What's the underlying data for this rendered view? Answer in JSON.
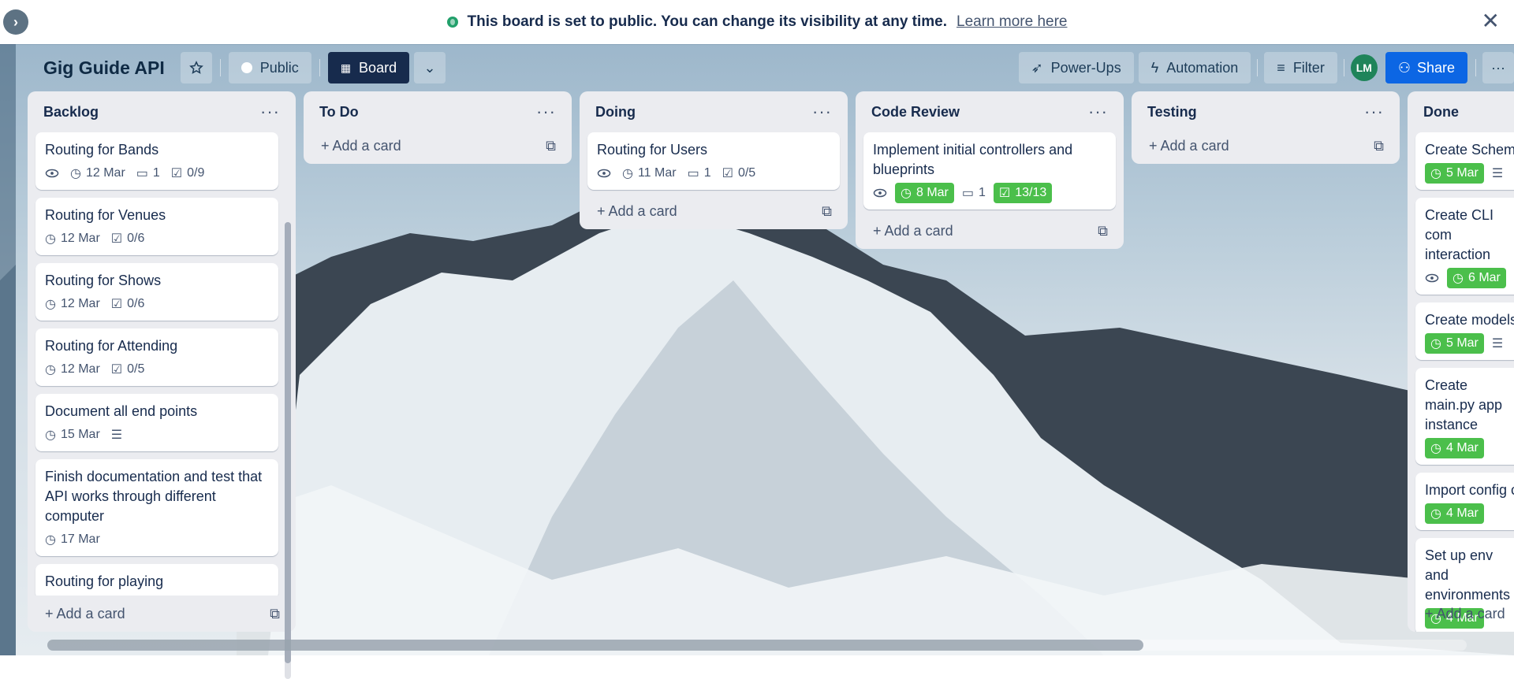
{
  "banner": {
    "message": "This board is set to public. You can change its visibility at any time.",
    "link": "Learn more here",
    "close": "✕",
    "expand": "›"
  },
  "board": {
    "title": "Gig Guide API",
    "visibility": "Public",
    "view": "Board",
    "powerups": "Power-Ups",
    "automation": "Automation",
    "filter": "Filter",
    "avatar": "LM",
    "share": "Share",
    "more": "···"
  },
  "common": {
    "add_card": "Add a card",
    "menu": "···"
  },
  "lists": [
    {
      "title": "Backlog",
      "cards": [
        {
          "title": "Routing for Bands",
          "watch": true,
          "date": "12 Mar",
          "comments": "1",
          "checklist": "0/9"
        },
        {
          "title": "Routing for Venues",
          "date": "12 Mar",
          "checklist": "0/6"
        },
        {
          "title": "Routing for Shows",
          "date": "12 Mar",
          "checklist": "0/6"
        },
        {
          "title": "Routing for Attending",
          "date": "12 Mar",
          "checklist": "0/5"
        },
        {
          "title": "Document all end points",
          "date": "15 Mar",
          "description": true
        },
        {
          "title": "Finish documentation and test that API works through different computer",
          "date": "17 Mar"
        },
        {
          "title": "Routing for playing"
        }
      ]
    },
    {
      "title": "To Do",
      "cards": []
    },
    {
      "title": "Doing",
      "cards": [
        {
          "title": "Routing for Users",
          "watch": true,
          "date": "11 Mar",
          "comments": "1",
          "checklist": "0/5"
        }
      ]
    },
    {
      "title": "Code Review",
      "cards": [
        {
          "title": "Implement initial controllers and blueprints",
          "watch": true,
          "date": "8 Mar",
          "date_done": true,
          "comments": "1",
          "checklist": "13/13",
          "checklist_done": true
        }
      ]
    },
    {
      "title": "Testing",
      "cards": []
    },
    {
      "title": "Done",
      "cards": [
        {
          "title": "Create Schema",
          "date": "5 Mar",
          "date_done": true,
          "description": true
        },
        {
          "title": "Create CLI com interaction",
          "watch": true,
          "date": "6 Mar",
          "date_done": true
        },
        {
          "title": "Create models",
          "date": "5 Mar",
          "date_done": true,
          "description": true
        },
        {
          "title": "Create main.py app instance",
          "date": "4 Mar",
          "date_done": true
        },
        {
          "title": "Import config c",
          "date": "4 Mar",
          "date_done": true
        },
        {
          "title": "Set up env and environments",
          "date": "4 Mar",
          "date_done": true
        }
      ]
    }
  ]
}
